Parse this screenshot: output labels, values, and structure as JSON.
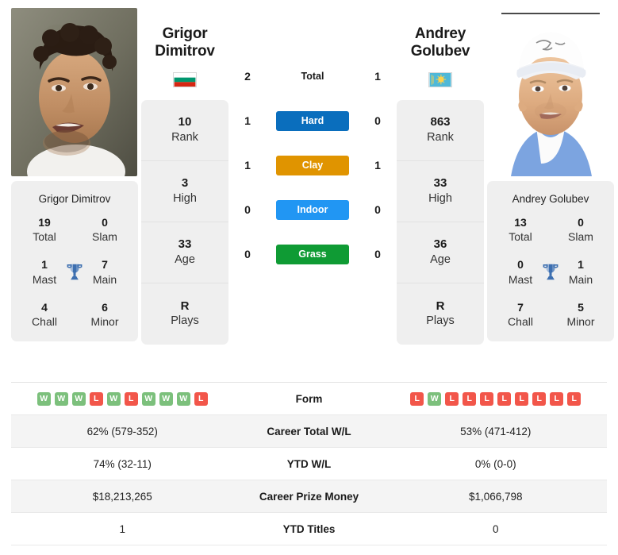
{
  "players": {
    "left": {
      "first_name": "Grigor",
      "last_name": "Dimitrov",
      "full_name": "Grigor Dimitrov",
      "country": "Bulgaria",
      "flag_icon": "bulgaria-flag-icon",
      "photo_alt": "Grigor Dimitrov photo",
      "info": [
        {
          "value": "10",
          "label": "Rank"
        },
        {
          "value": "3",
          "label": "High"
        },
        {
          "value": "33",
          "label": "Age"
        },
        {
          "value": "R",
          "label": "Plays"
        }
      ],
      "titles": [
        {
          "value": "19",
          "label": "Total"
        },
        {
          "value": "0",
          "label": "Slam"
        },
        {
          "value": "1",
          "label": "Mast"
        },
        {
          "value": "7",
          "label": "Main"
        },
        {
          "value": "4",
          "label": "Chall"
        },
        {
          "value": "6",
          "label": "Minor"
        }
      ],
      "form": [
        "W",
        "W",
        "W",
        "L",
        "W",
        "L",
        "W",
        "W",
        "W",
        "L"
      ],
      "career_total_wl": "62% (579-352)",
      "ytd_wl": "74% (32-11)",
      "career_prize_money": "$18,213,265",
      "ytd_titles": "1"
    },
    "right": {
      "first_name": "Andrey",
      "last_name": "Golubev",
      "full_name": "Andrey Golubev",
      "country": "Kazakhstan",
      "flag_icon": "kazakhstan-flag-icon",
      "photo_alt": "Andrey Golubev photo",
      "info": [
        {
          "value": "863",
          "label": "Rank"
        },
        {
          "value": "33",
          "label": "High"
        },
        {
          "value": "36",
          "label": "Age"
        },
        {
          "value": "R",
          "label": "Plays"
        }
      ],
      "titles": [
        {
          "value": "13",
          "label": "Total"
        },
        {
          "value": "0",
          "label": "Slam"
        },
        {
          "value": "0",
          "label": "Mast"
        },
        {
          "value": "1",
          "label": "Main"
        },
        {
          "value": "7",
          "label": "Chall"
        },
        {
          "value": "5",
          "label": "Minor"
        }
      ],
      "form": [
        "L",
        "W",
        "L",
        "L",
        "L",
        "L",
        "L",
        "L",
        "L",
        "L"
      ],
      "career_total_wl": "53% (471-412)",
      "ytd_wl": "0% (0-0)",
      "career_prize_money": "$1,066,798",
      "ytd_titles": "0"
    }
  },
  "head_to_head": [
    {
      "label": "Total",
      "left": "2",
      "right": "1",
      "color": "transparent",
      "is_total": true
    },
    {
      "label": "Hard",
      "left": "1",
      "right": "0",
      "color": "#0a6ebd",
      "is_total": false
    },
    {
      "label": "Clay",
      "left": "1",
      "right": "1",
      "color": "#e09400",
      "is_total": false
    },
    {
      "label": "Indoor",
      "left": "0",
      "right": "0",
      "color": "#2196f3",
      "is_total": false
    },
    {
      "label": "Grass",
      "left": "0",
      "right": "0",
      "color": "#0f9b34",
      "is_total": false
    }
  ],
  "stats_rows": [
    {
      "label": "Form",
      "left": "",
      "right": "",
      "type": "form"
    },
    {
      "label": "Career Total W/L",
      "left": "62% (579-352)",
      "right": "53% (471-412)",
      "type": "text"
    },
    {
      "label": "YTD W/L",
      "left": "74% (32-11)",
      "right": "0% (0-0)",
      "type": "text"
    },
    {
      "label": "Career Prize Money",
      "left": "$18,213,265",
      "right": "$1,066,798",
      "type": "text"
    },
    {
      "label": "YTD Titles",
      "left": "1",
      "right": "0",
      "type": "text"
    }
  ],
  "icons": {
    "trophy": "trophy-icon"
  },
  "colors": {
    "hard": "#0a6ebd",
    "clay": "#e09400",
    "indoor": "#2196f3",
    "grass": "#0f9b34",
    "win": "#7cc07c",
    "loss": "#f2564a",
    "trophy": "#3d6fb0",
    "card_bg": "#efefef",
    "row_alt_bg": "#f4f4f4"
  }
}
